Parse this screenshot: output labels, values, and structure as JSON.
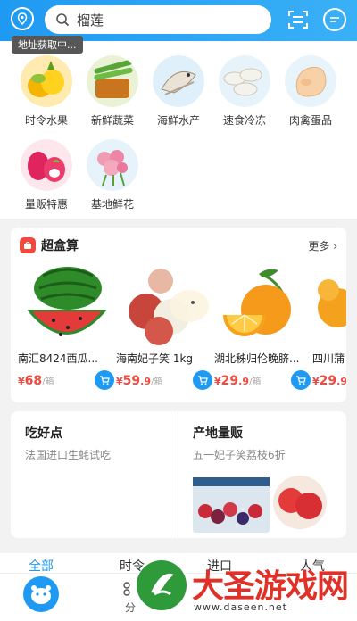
{
  "header": {
    "search_text": "榴莲",
    "location_tip": "地址获取中..."
  },
  "categories": [
    {
      "label": "时令水果",
      "icon": "fruit-icon"
    },
    {
      "label": "新鲜蔬菜",
      "icon": "vegetable-icon"
    },
    {
      "label": "海鲜水产",
      "icon": "seafood-icon"
    },
    {
      "label": "速食冷冻",
      "icon": "frozen-food-icon"
    },
    {
      "label": "肉禽蛋品",
      "icon": "meat-icon"
    },
    {
      "label": "量贩特惠",
      "icon": "discount-icon"
    },
    {
      "label": "基地鲜花",
      "icon": "flower-icon"
    }
  ],
  "box_deal": {
    "title": "超盒算",
    "more": "更多",
    "products": [
      {
        "name": "南汇8424西瓜...",
        "currency": "¥",
        "price_int": "68",
        "price_dec": "",
        "unit": "/箱"
      },
      {
        "name": "海南妃子笑 1kg",
        "currency": "¥",
        "price_int": "59",
        "price_dec": ".9",
        "unit": "/箱"
      },
      {
        "name": "湖北秭归伦晚脐...",
        "currency": "¥",
        "price_int": "29",
        "price_dec": ".9",
        "unit": "/箱"
      },
      {
        "name": "四川蒲",
        "currency": "¥",
        "price_int": "29",
        "price_dec": ".9",
        "unit": ""
      }
    ]
  },
  "promo": {
    "left_title": "吃好点",
    "left_sub": "法国进口生蚝试吃",
    "right_title": "产地量贩",
    "right_sub": "五一妃子笑荔枝6折"
  },
  "tabs": [
    "全部",
    "时令",
    "进口",
    "人气"
  ],
  "navbar": {
    "category_label": "分"
  },
  "watermark": {
    "title": "大圣游戏网",
    "url": "www.daseen.net"
  },
  "colors": {
    "accent": "#1f9af2",
    "price": "#f2493e"
  }
}
